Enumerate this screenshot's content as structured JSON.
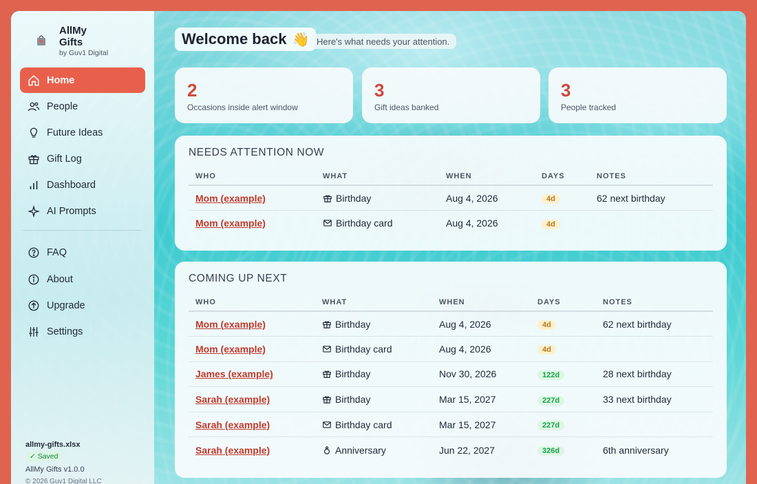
{
  "brand": {
    "title_line1": "AllMy",
    "title_line2": "Gifts",
    "subtitle": "by Guv1 Digital"
  },
  "nav": {
    "primary": [
      {
        "label": "Home",
        "icon": "home-icon",
        "active": true
      },
      {
        "label": "People",
        "icon": "people-icon"
      },
      {
        "label": "Future Ideas",
        "icon": "lightbulb-icon"
      },
      {
        "label": "Gift Log",
        "icon": "gift-icon"
      },
      {
        "label": "Dashboard",
        "icon": "bar-chart-icon"
      },
      {
        "label": "AI Prompts",
        "icon": "sparkle-icon"
      }
    ],
    "secondary": [
      {
        "label": "FAQ",
        "icon": "question-icon"
      },
      {
        "label": "About",
        "icon": "info-icon"
      },
      {
        "label": "Upgrade",
        "icon": "upgrade-arrow-icon"
      },
      {
        "label": "Settings",
        "icon": "sliders-icon"
      }
    ]
  },
  "footer": {
    "file": "allmy-gifts.xlsx",
    "status": "✓ Saved",
    "version": "AllMy Gifts v1.0.0",
    "copyright": "© 2026 Guv1 Digital LLC"
  },
  "header": {
    "title": "Welcome back",
    "emoji": "👋",
    "subtitle": "Here's what needs your attention."
  },
  "stats": [
    {
      "value": "2",
      "label": "Occasions inside alert window"
    },
    {
      "value": "3",
      "label": "Gift ideas banked"
    },
    {
      "value": "3",
      "label": "People tracked"
    }
  ],
  "columns": [
    "WHO",
    "WHAT",
    "WHEN",
    "DAYS",
    "NOTES"
  ],
  "attention": {
    "title": "NEEDS ATTENTION NOW",
    "rows": [
      {
        "who": "Mom (example)",
        "what": "Birthday",
        "icon": "gift-icon",
        "when": "Aug 4, 2026",
        "days": "4d",
        "urgency": "soon",
        "notes": "62 next birthday"
      },
      {
        "who": "Mom (example)",
        "what": "Birthday card",
        "icon": "envelope-icon",
        "when": "Aug 4, 2026",
        "days": "4d",
        "urgency": "soon",
        "notes": ""
      }
    ]
  },
  "upcoming": {
    "title": "COMING UP NEXT",
    "rows": [
      {
        "who": "Mom (example)",
        "what": "Birthday",
        "icon": "gift-icon",
        "when": "Aug 4, 2026",
        "days": "4d",
        "urgency": "soon",
        "notes": "62 next birthday"
      },
      {
        "who": "Mom (example)",
        "what": "Birthday card",
        "icon": "envelope-icon",
        "when": "Aug 4, 2026",
        "days": "4d",
        "urgency": "soon",
        "notes": ""
      },
      {
        "who": "James (example)",
        "what": "Birthday",
        "icon": "gift-icon",
        "when": "Nov 30, 2026",
        "days": "122d",
        "urgency": "later",
        "notes": "28 next birthday"
      },
      {
        "who": "Sarah (example)",
        "what": "Birthday",
        "icon": "gift-icon",
        "when": "Mar 15, 2027",
        "days": "227d",
        "urgency": "later",
        "notes": "33 next birthday"
      },
      {
        "who": "Sarah (example)",
        "what": "Birthday card",
        "icon": "envelope-icon",
        "when": "Mar 15, 2027",
        "days": "227d",
        "urgency": "later",
        "notes": ""
      },
      {
        "who": "Sarah (example)",
        "what": "Anniversary",
        "icon": "ring-icon",
        "when": "Jun 22, 2027",
        "days": "326d",
        "urgency": "later",
        "notes": "6th anniversary"
      }
    ]
  },
  "colors": {
    "accent": "#e8604c",
    "link": "#c0392b",
    "soon_pill": "#fdf0cf",
    "later_pill": "#ddf5e4"
  }
}
